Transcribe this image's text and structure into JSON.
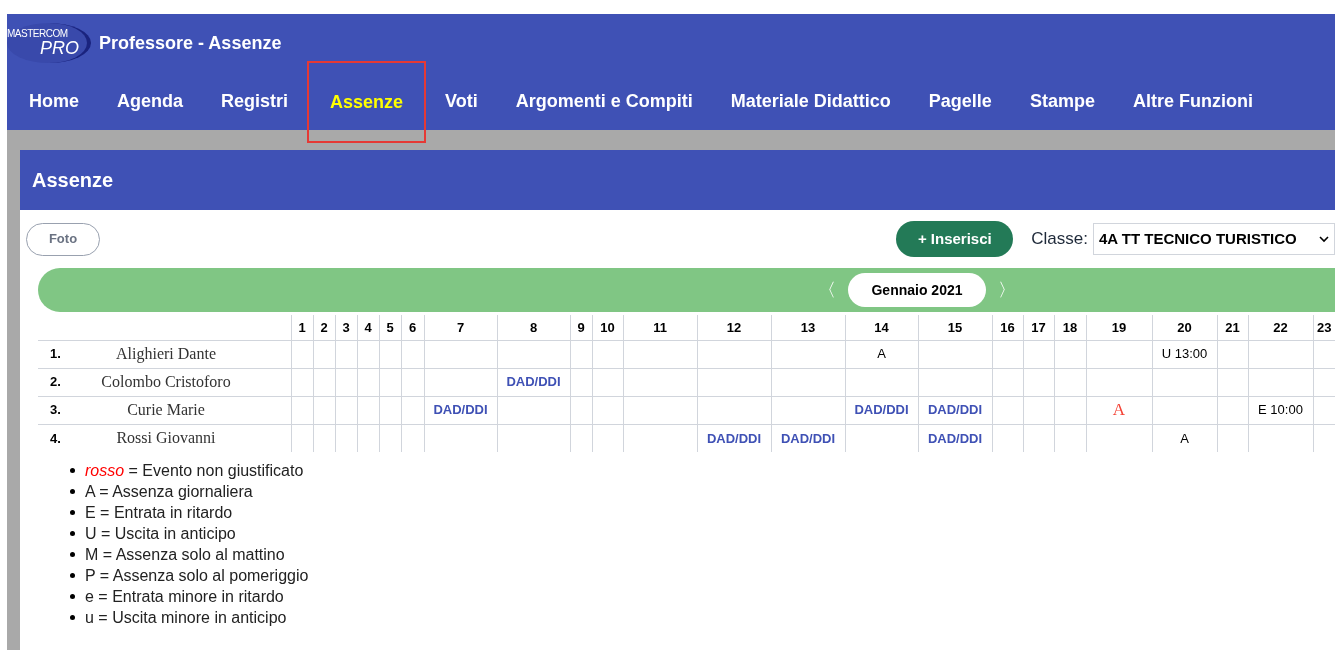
{
  "logo": {
    "line_1": "MASTERCOM",
    "line_2": "PRO"
  },
  "window": {
    "title": "Professore - Assenze"
  },
  "tabs": [
    {
      "label": "Home",
      "selected": false
    },
    {
      "label": "Agenda",
      "selected": false
    },
    {
      "label": "Registri",
      "selected": false
    },
    {
      "label": "Assenze",
      "selected": true
    },
    {
      "label": "Voti",
      "selected": false
    },
    {
      "label": "Argomenti e Compiti",
      "selected": false
    },
    {
      "label": "Materiale Didattico",
      "selected": false
    },
    {
      "label": "Pagelle",
      "selected": false
    },
    {
      "label": "Stampe",
      "selected": false
    },
    {
      "label": "Altre Funzioni",
      "selected": false
    }
  ],
  "panel": {
    "title": "Assenze"
  },
  "toolbar": {
    "photo_button": "Foto",
    "add_button": "+ Inserisci",
    "class_label": "Classe:",
    "class_value": "4A TT TECNICO TURISTICO"
  },
  "month_nav": {
    "prev": "〈",
    "month": "Gennaio 2021",
    "next": "〉"
  },
  "table": {
    "columns": [
      "1",
      "2",
      "3",
      "4",
      "5",
      "6",
      "7",
      "8",
      "9",
      "10",
      "11",
      "12",
      "13",
      "14",
      "15",
      "16",
      "17",
      "18",
      "19",
      "20",
      "21",
      "22",
      "23"
    ],
    "rows": [
      {
        "number": "1.",
        "name": "Alighieri Dante",
        "cells": [
          {
            "kind": "empty"
          },
          {
            "kind": "empty"
          },
          {
            "kind": "empty"
          },
          {
            "kind": "empty"
          },
          {
            "kind": "empty"
          },
          {
            "kind": "empty"
          },
          {
            "kind": "empty"
          },
          {
            "kind": "empty"
          },
          {
            "kind": "empty"
          },
          {
            "kind": "empty"
          },
          {
            "kind": "empty"
          },
          {
            "kind": "empty"
          },
          {
            "kind": "empty"
          },
          {
            "kind": "event",
            "text": "A",
            "unjustified": false
          },
          {
            "kind": "empty"
          },
          {
            "kind": "empty"
          },
          {
            "kind": "empty"
          },
          {
            "kind": "empty"
          },
          {
            "kind": "empty"
          },
          {
            "kind": "event",
            "text": "U 13:00",
            "unjustified": false
          },
          {
            "kind": "empty"
          },
          {
            "kind": "empty"
          },
          {
            "kind": "empty"
          }
        ]
      },
      {
        "number": "2.",
        "name": "Colombo Cristoforo",
        "cells": [
          {
            "kind": "empty"
          },
          {
            "kind": "empty"
          },
          {
            "kind": "empty"
          },
          {
            "kind": "empty"
          },
          {
            "kind": "empty"
          },
          {
            "kind": "empty"
          },
          {
            "kind": "empty"
          },
          {
            "kind": "dad",
            "text": "DAD/DDI"
          },
          {
            "kind": "empty"
          },
          {
            "kind": "empty"
          },
          {
            "kind": "empty"
          },
          {
            "kind": "empty"
          },
          {
            "kind": "empty"
          },
          {
            "kind": "empty"
          },
          {
            "kind": "empty"
          },
          {
            "kind": "empty"
          },
          {
            "kind": "empty"
          },
          {
            "kind": "empty"
          },
          {
            "kind": "empty"
          },
          {
            "kind": "empty"
          },
          {
            "kind": "empty"
          },
          {
            "kind": "empty"
          },
          {
            "kind": "empty"
          }
        ]
      },
      {
        "number": "3.",
        "name": "Curie Marie",
        "cells": [
          {
            "kind": "empty"
          },
          {
            "kind": "empty"
          },
          {
            "kind": "empty"
          },
          {
            "kind": "empty"
          },
          {
            "kind": "empty"
          },
          {
            "kind": "empty"
          },
          {
            "kind": "dad",
            "text": "DAD/DDI"
          },
          {
            "kind": "empty"
          },
          {
            "kind": "empty"
          },
          {
            "kind": "empty"
          },
          {
            "kind": "empty"
          },
          {
            "kind": "empty"
          },
          {
            "kind": "empty"
          },
          {
            "kind": "dad",
            "text": "DAD/DDI"
          },
          {
            "kind": "dad",
            "text": "DAD/DDI"
          },
          {
            "kind": "empty"
          },
          {
            "kind": "empty"
          },
          {
            "kind": "empty"
          },
          {
            "kind": "event",
            "text": "A",
            "unjustified": true
          },
          {
            "kind": "empty"
          },
          {
            "kind": "empty"
          },
          {
            "kind": "event",
            "text": "E 10:00",
            "unjustified": false
          },
          {
            "kind": "empty"
          }
        ]
      },
      {
        "number": "4.",
        "name": "Rossi Giovanni",
        "cells": [
          {
            "kind": "empty"
          },
          {
            "kind": "empty"
          },
          {
            "kind": "empty"
          },
          {
            "kind": "empty"
          },
          {
            "kind": "empty"
          },
          {
            "kind": "empty"
          },
          {
            "kind": "empty"
          },
          {
            "kind": "empty"
          },
          {
            "kind": "empty"
          },
          {
            "kind": "empty"
          },
          {
            "kind": "empty"
          },
          {
            "kind": "dad",
            "text": "DAD/DDI"
          },
          {
            "kind": "dad",
            "text": "DAD/DDI"
          },
          {
            "kind": "empty"
          },
          {
            "kind": "dad",
            "text": "DAD/DDI"
          },
          {
            "kind": "empty"
          },
          {
            "kind": "empty"
          },
          {
            "kind": "empty"
          },
          {
            "kind": "empty"
          },
          {
            "kind": "event",
            "text": "A",
            "unjustified": false
          },
          {
            "kind": "empty"
          },
          {
            "kind": "empty"
          },
          {
            "kind": "empty"
          }
        ]
      }
    ]
  },
  "legend": [
    "*rosso* = Evento non giustificato",
    "A = Assenza giornaliera",
    "E = Entrata in ritardo",
    "U = Uscita in anticipo",
    "M = Assenza solo al mattino",
    "P = Assenza solo al pomeriggio",
    "e = Entrata minore in ritardo",
    "u = Uscita minore in anticipo"
  ]
}
